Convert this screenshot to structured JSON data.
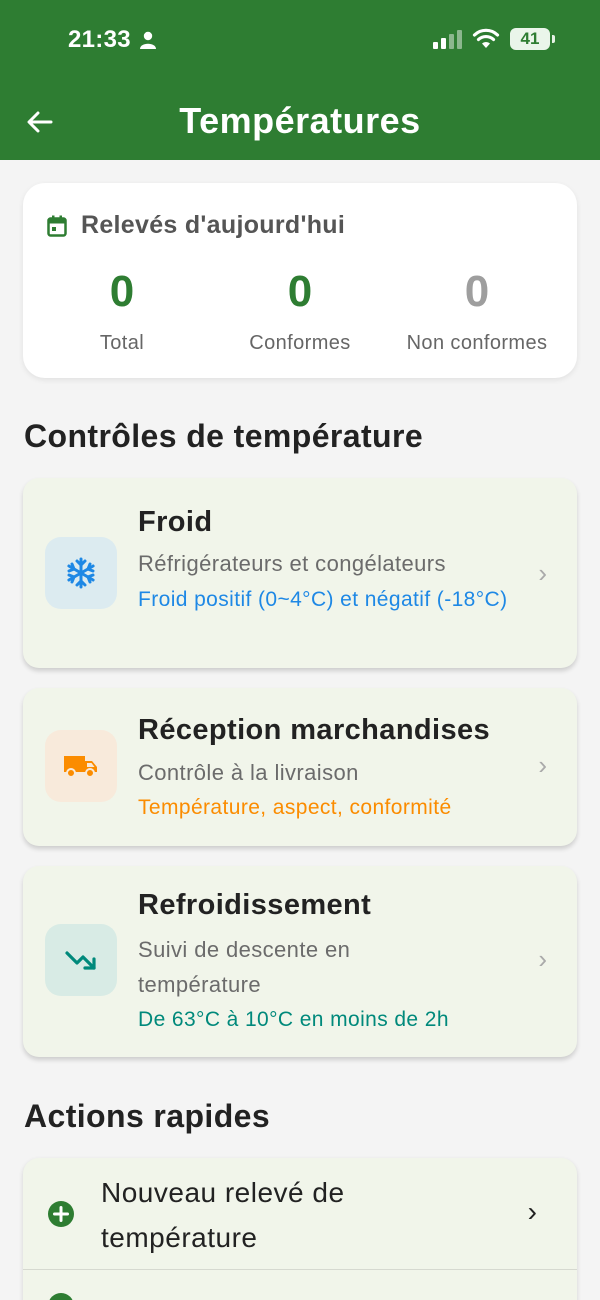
{
  "status_bar": {
    "time": "21:33",
    "battery": "41"
  },
  "header": {
    "title": "Températures"
  },
  "summary": {
    "heading": "Relevés d'aujourd'hui",
    "stats": [
      {
        "value": "0",
        "label": "Total",
        "color": "#2e7d32"
      },
      {
        "value": "0",
        "label": "Conformes",
        "color": "#2e7d32"
      },
      {
        "value": "0",
        "label": "Non conformes",
        "color": "#9e9e9e"
      }
    ]
  },
  "controls": {
    "heading": "Contrôles de température",
    "cards": [
      {
        "title": "Froid",
        "subtitle": "Réfrigérateurs et congélateurs",
        "note": "Froid positif (0~4°C) et négatif (-18°C)",
        "icon": "snowflake-icon",
        "accent": "#1e88e5"
      },
      {
        "title": "Réception marchandises",
        "subtitle": "Contrôle à la livraison",
        "note": "Température, aspect, conformité",
        "icon": "truck-icon",
        "accent": "#fb8c00"
      },
      {
        "title": "Refroidissement",
        "subtitle": "Suivi de descente en température",
        "note": "De 63°C à 10°C en moins de 2h",
        "icon": "trending-down-icon",
        "accent": "#00897b"
      }
    ]
  },
  "quick_actions": {
    "heading": "Actions rapides",
    "items": [
      {
        "label": "Nouveau relevé de température",
        "icon": "add-circle-icon"
      }
    ]
  }
}
